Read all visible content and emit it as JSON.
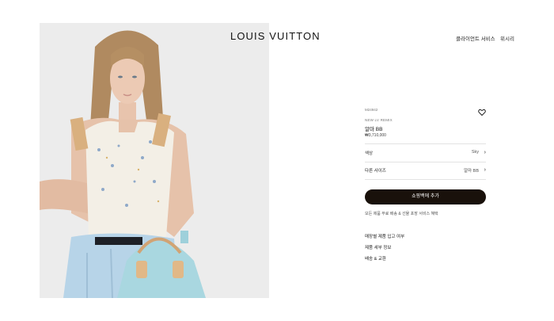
{
  "header": {
    "brand": "LOUIS VUITTON",
    "nav": [
      "클라이언트 서비스",
      "위시리"
    ]
  },
  "product": {
    "sku": "M24942",
    "collection": "NEW LV REMIX",
    "name": "알마 BB",
    "price": "₩3,710,000",
    "options": [
      {
        "label": "색상",
        "value": "Sky"
      },
      {
        "label": "다른 사이즈",
        "value": "알마 BB"
      }
    ],
    "add_to_cart": "쇼핑백에 추가",
    "shipping_note": "모든 제품 무료 배송 & 선물 포장 서비스 혜택",
    "links": [
      "매장별 제품 입고 여부",
      "제품 세부 정보",
      "배송 & 교환"
    ]
  },
  "icons": {
    "wishlist": "heart-icon",
    "chevron": "chevron-right-icon"
  },
  "colors": {
    "button": "#19110b",
    "bag": "#a9d7e0"
  }
}
